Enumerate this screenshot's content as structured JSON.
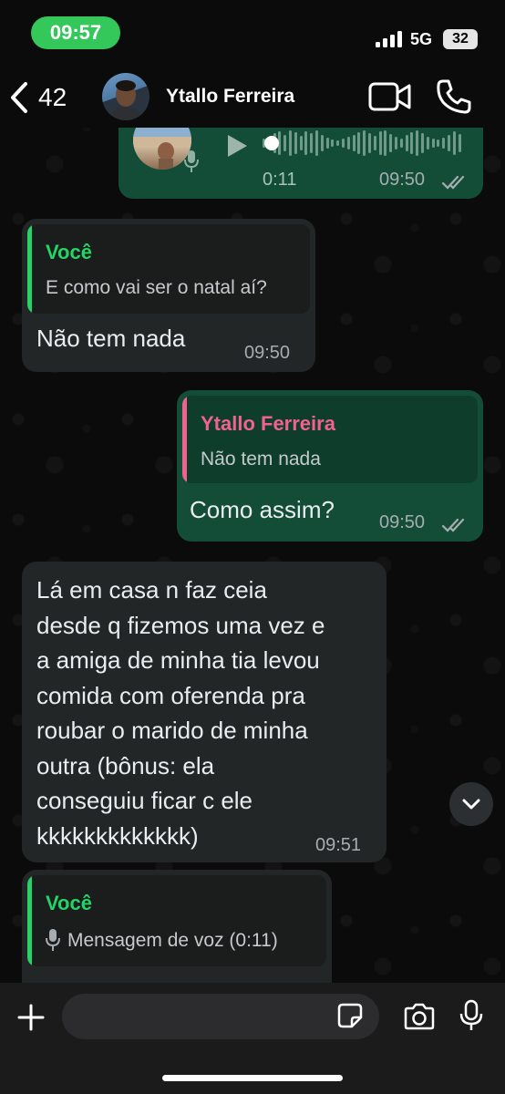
{
  "status_bar": {
    "time": "09:57",
    "network": "5G",
    "battery": "32"
  },
  "header": {
    "back_count": "42",
    "contact_name": "Ytallo Ferreira"
  },
  "messages": [
    {
      "type": "voice",
      "direction": "out",
      "duration": "0:11",
      "time": "09:50",
      "status": "read"
    },
    {
      "type": "text",
      "direction": "in",
      "quote_author": "Você",
      "quote_text": "E como vai ser o natal aí?",
      "text": "Não tem nada",
      "time": "09:50"
    },
    {
      "type": "text",
      "direction": "out",
      "quote_author": "Ytallo Ferreira",
      "quote_text": "Não tem nada",
      "text": "Como assim?",
      "time": "09:50",
      "status": "read"
    },
    {
      "type": "text",
      "direction": "in",
      "lines": [
        "Lá em casa n faz ceia",
        "desde q fizemos uma vez e",
        "a amiga de minha tia levou",
        "comida com oferenda pra",
        "roubar o marido de minha",
        "outra (bônus: ela",
        "conseguiu ficar c ele",
        "kkkkkkkkkkkkk)"
      ],
      "time": "09:51"
    },
    {
      "type": "text",
      "direction": "in",
      "quote_author": "Você",
      "quote_text": "Mensagem de voz (0:11)",
      "quote_icon": "mic-icon"
    }
  ],
  "colors": {
    "outgoing_bubble": "#134d37",
    "incoming_bubble": "#232626",
    "quote_you": "#25d366",
    "quote_contact": "#f06292",
    "read_ticks": "#a6adb0",
    "status_pill": "#34c759"
  },
  "icons": [
    "chevron-left-icon",
    "video-call-icon",
    "phone-icon",
    "play-icon",
    "mic-icon",
    "double-check-icon",
    "chevron-down-icon",
    "plus-icon",
    "sticker-icon",
    "camera-icon"
  ]
}
